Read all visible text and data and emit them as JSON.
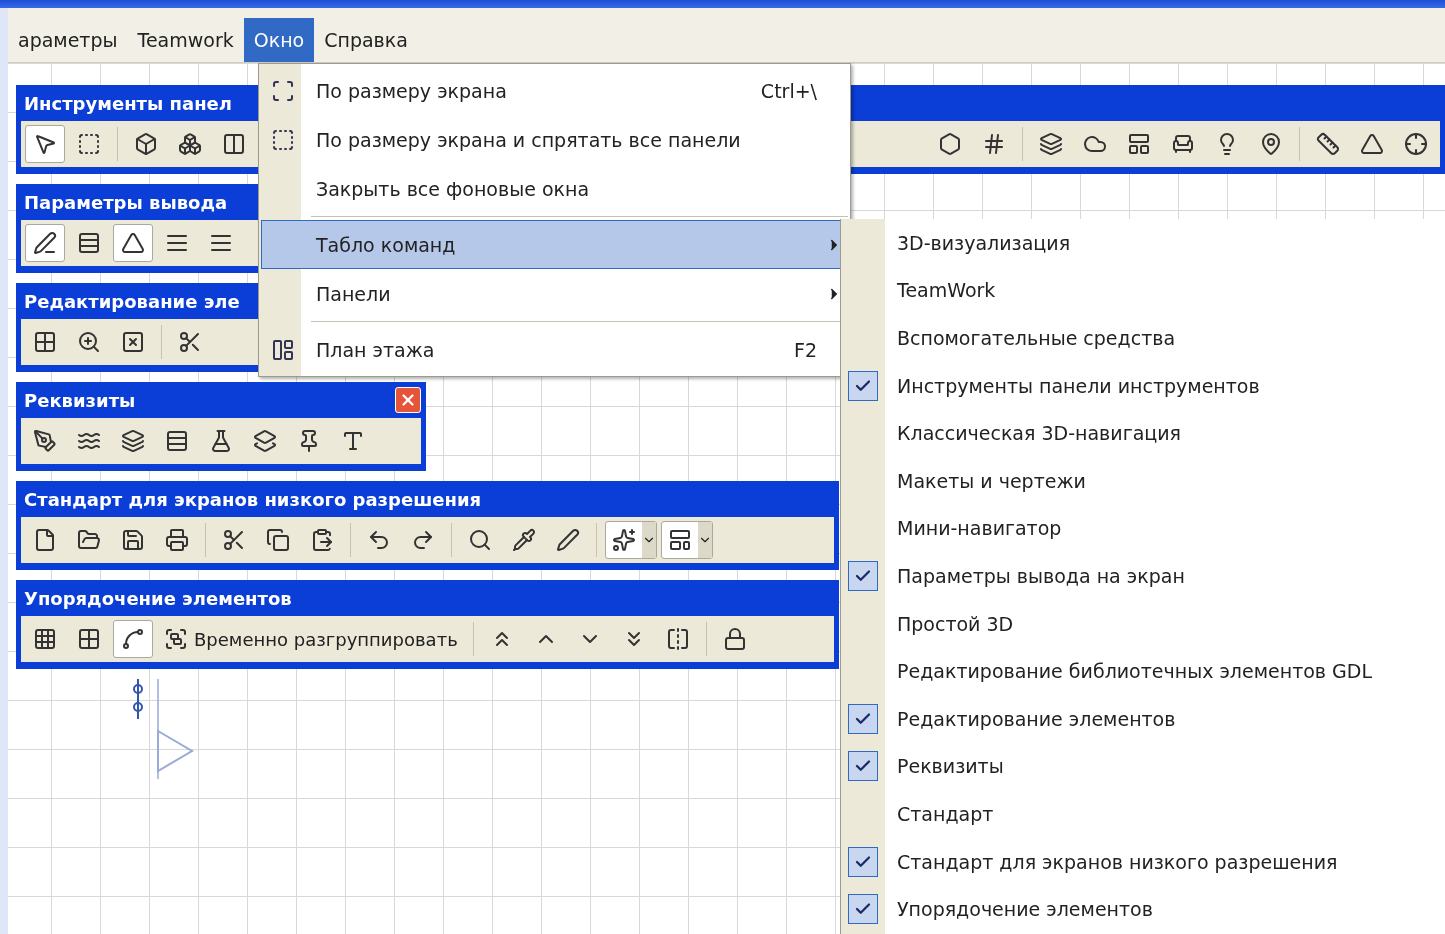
{
  "menubar": [
    {
      "label": "араметры",
      "selected": false
    },
    {
      "label": "Teamwork",
      "selected": false
    },
    {
      "label": "Окно",
      "selected": true
    },
    {
      "label": "Справка",
      "selected": false
    }
  ],
  "toolbars": [
    {
      "title": "Инструменты панел",
      "buttons": [
        {
          "kind": "icon",
          "selected": true
        },
        {
          "kind": "icon",
          "selected": false
        },
        {
          "kind": "separator"
        },
        {
          "kind": "icon",
          "selected": false
        },
        {
          "kind": "icon",
          "selected": false
        },
        {
          "kind": "icon",
          "selected": false
        }
      ],
      "trailing_buttons": [
        {
          "kind": "icon",
          "selected": false
        },
        {
          "kind": "icon",
          "selected": false
        },
        {
          "kind": "separator"
        },
        {
          "kind": "icon",
          "selected": false
        },
        {
          "kind": "icon",
          "selected": false
        },
        {
          "kind": "icon",
          "selected": false
        },
        {
          "kind": "icon",
          "selected": false
        },
        {
          "kind": "icon",
          "selected": false
        },
        {
          "kind": "icon",
          "selected": false
        },
        {
          "kind": "separator"
        },
        {
          "kind": "icon",
          "selected": false
        },
        {
          "kind": "icon",
          "selected": false
        },
        {
          "kind": "icon",
          "selected": false
        }
      ]
    },
    {
      "title": "Параметры вывода",
      "buttons": [
        {
          "kind": "icon",
          "selected": true
        },
        {
          "kind": "icon",
          "selected": false
        },
        {
          "kind": "icon",
          "selected": true
        },
        {
          "kind": "icon",
          "selected": false
        },
        {
          "kind": "icon",
          "selected": false
        }
      ]
    },
    {
      "title": "Редактирование эле",
      "buttons": [
        {
          "kind": "icon",
          "selected": false
        },
        {
          "kind": "icon",
          "selected": false
        },
        {
          "kind": "icon",
          "selected": false
        },
        {
          "kind": "separator"
        },
        {
          "kind": "icon",
          "selected": false
        }
      ]
    },
    {
      "title": "Реквизиты",
      "closable": true,
      "buttons": [
        {
          "kind": "icon",
          "selected": false
        },
        {
          "kind": "icon",
          "selected": false
        },
        {
          "kind": "icon",
          "selected": false
        },
        {
          "kind": "icon",
          "selected": false
        },
        {
          "kind": "icon",
          "selected": false
        },
        {
          "kind": "icon",
          "selected": false
        },
        {
          "kind": "icon",
          "selected": false
        },
        {
          "kind": "icon",
          "selected": false
        }
      ]
    },
    {
      "title": "Стандарт для экранов низкого разрешения",
      "buttons": [
        {
          "kind": "icon",
          "selected": false
        },
        {
          "kind": "icon",
          "selected": false
        },
        {
          "kind": "icon",
          "selected": false
        },
        {
          "kind": "icon",
          "selected": false
        },
        {
          "kind": "separator"
        },
        {
          "kind": "icon",
          "selected": false
        },
        {
          "kind": "icon",
          "selected": false
        },
        {
          "kind": "icon",
          "selected": false
        },
        {
          "kind": "separator"
        },
        {
          "kind": "icon",
          "selected": false
        },
        {
          "kind": "icon",
          "selected": false
        },
        {
          "kind": "separator"
        },
        {
          "kind": "icon",
          "selected": false
        },
        {
          "kind": "icon",
          "selected": false
        },
        {
          "kind": "icon",
          "selected": false
        },
        {
          "kind": "separator"
        },
        {
          "kind": "dropdown",
          "selected": true
        },
        {
          "kind": "dropdown",
          "selected": true
        }
      ]
    },
    {
      "title": "Упорядочение элементов",
      "buttons": [
        {
          "kind": "icon",
          "selected": false
        },
        {
          "kind": "icon",
          "selected": false
        },
        {
          "kind": "icon",
          "selected": true
        },
        {
          "kind": "text",
          "label": "Временно разгруппировать",
          "selected": false
        },
        {
          "kind": "separator"
        },
        {
          "kind": "icon",
          "selected": false
        },
        {
          "kind": "icon",
          "selected": false
        },
        {
          "kind": "icon",
          "selected": false
        },
        {
          "kind": "icon",
          "selected": false
        },
        {
          "kind": "icon",
          "selected": false
        },
        {
          "kind": "separator"
        },
        {
          "kind": "icon",
          "selected": false
        }
      ]
    }
  ],
  "window_menu": {
    "items": [
      {
        "kind": "item",
        "label": "По размеру экрана",
        "shortcut": "Ctrl+\\",
        "selected": false
      },
      {
        "kind": "item",
        "label": "По размеру экрана и спрятать все панели",
        "selected": false
      },
      {
        "kind": "item",
        "label": "Закрыть все фоновые окна",
        "selected": false
      },
      {
        "kind": "separator"
      },
      {
        "kind": "item",
        "label": "Табло команд",
        "selected": true,
        "submenu": true
      },
      {
        "kind": "item",
        "label": "Панели",
        "selected": false,
        "submenu": true
      },
      {
        "kind": "separator"
      },
      {
        "kind": "item",
        "label": "План этажа",
        "shortcut": "F2",
        "selected": false
      }
    ]
  },
  "submenu": {
    "items": [
      {
        "label": "3D-визуализация",
        "checked": false
      },
      {
        "label": "TeamWork",
        "checked": false
      },
      {
        "label": "Вспомогательные средства",
        "checked": false
      },
      {
        "label": "Инструменты панели инструментов",
        "checked": true
      },
      {
        "label": "Классическая 3D-навигация",
        "checked": false
      },
      {
        "label": "Макеты и чертежи",
        "checked": false
      },
      {
        "label": "Мини-навигатор",
        "checked": false
      },
      {
        "label": "Параметры вывода на экран",
        "checked": true
      },
      {
        "label": "Простой 3D",
        "checked": false
      },
      {
        "label": "Редактирование библиотечных элементов GDL",
        "checked": false
      },
      {
        "label": "Редактирование элементов",
        "checked": true
      },
      {
        "label": "Реквизиты",
        "checked": true
      },
      {
        "label": "Стандарт",
        "checked": false
      },
      {
        "label": "Стандарт для экранов низкого разрешения",
        "checked": true
      },
      {
        "label": "Упорядочение элементов",
        "checked": true
      }
    ]
  }
}
